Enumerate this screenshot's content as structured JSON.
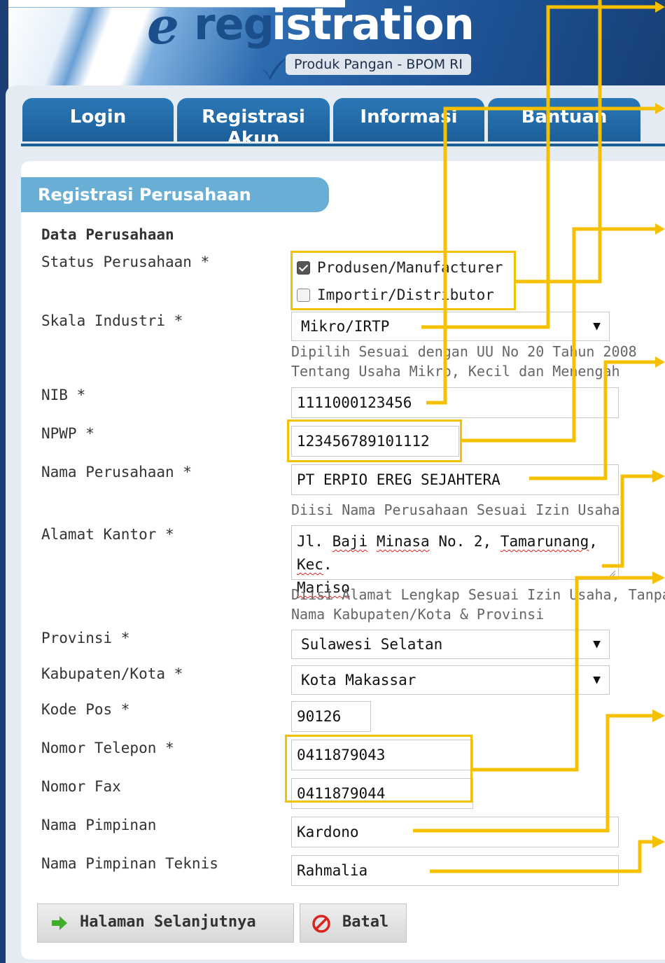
{
  "header": {
    "logo_e": "e",
    "logo_reg": "reg",
    "logo_istration": "istration",
    "subtitle": "Produk Pangan - BPOM RI"
  },
  "tabs": [
    {
      "label": "Login"
    },
    {
      "label": "Registrasi Akun"
    },
    {
      "label": "Informasi"
    },
    {
      "label": "Bantuan"
    }
  ],
  "section": {
    "title": "Registrasi Perusahaan",
    "subtitle": "Data Perusahaan"
  },
  "form": {
    "status": {
      "label": "Status Perusahaan *",
      "options": [
        {
          "label": "Produsen/Manufacturer",
          "checked": true
        },
        {
          "label": "Importir/Distributor",
          "checked": false
        }
      ]
    },
    "skala": {
      "label": "Skala Industri *",
      "value": "Mikro/IRTP",
      "hint1": "Dipilih Sesuai dengan UU No 20 Tahun 2008",
      "hint2": "Tentang Usaha Mikro, Kecil dan Menengah"
    },
    "nib": {
      "label": "NIB *",
      "value": "1111000123456"
    },
    "npwp": {
      "label": "NPWP *",
      "value": "123456789101112"
    },
    "nama_perusahaan": {
      "label": "Nama Perusahaan *",
      "value": "PT ERPIO EREG SEJAHTERA",
      "hint": "Diisi Nama Perusahaan Sesuai Izin Usaha"
    },
    "alamat": {
      "label": "Alamat Kantor *",
      "line1_a": "Jl. ",
      "line1_b": "Baji",
      "line1_c": " ",
      "line1_d": "Minasa",
      "line1_e": " No. 2, ",
      "line1_f": "Tamarunang",
      "line1_g": ", ",
      "line1_h": "Kec",
      "line1_i": ".",
      "line2": "Mariso",
      "hint1": "Diisi Alamat Lengkap Sesuai Izin Usaha, Tanpa",
      "hint2": "Nama Kabupaten/Kota & Provinsi"
    },
    "provinsi": {
      "label": "Provinsi *",
      "value": "Sulawesi Selatan"
    },
    "kabupaten": {
      "label": "Kabupaten/Kota *",
      "value": "Kota Makassar"
    },
    "kode_pos": {
      "label": "Kode Pos *",
      "value": "90126"
    },
    "telepon": {
      "label": "Nomor Telepon *",
      "value": "0411879043"
    },
    "fax": {
      "label": "Nomor Fax",
      "value": "0411879044"
    },
    "pimpinan": {
      "label": "Nama Pimpinan",
      "value": "Kardono"
    },
    "pimpinan_teknis": {
      "label": "Nama Pimpinan Teknis",
      "value": "Rahmalia"
    }
  },
  "buttons": {
    "next": {
      "label": "Halaman Selanjutnya",
      "icon": "arrow-right-icon"
    },
    "cancel": {
      "label": "Batal",
      "icon": "cancel-icon"
    }
  },
  "colors": {
    "highlight": "#f5c000",
    "tab_blue": "#1b5f9a",
    "section_blue": "#69aed4"
  }
}
